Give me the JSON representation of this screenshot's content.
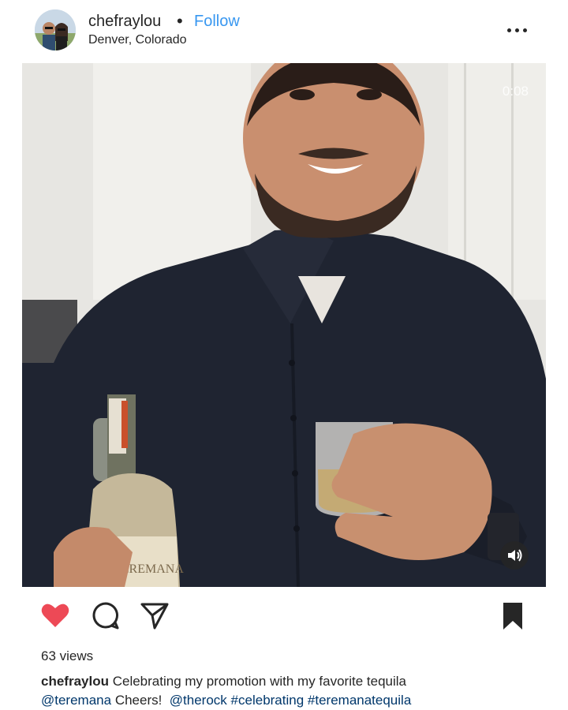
{
  "post": {
    "username": "chefraylou",
    "separator": "•",
    "follow_label": "Follow",
    "location": "Denver, Colorado"
  },
  "video": {
    "timer": "0:08",
    "bottle_label": "TEREMANA"
  },
  "actions": {
    "like_icon": "heart-icon",
    "comment_icon": "comment-icon",
    "share_icon": "send-icon",
    "save_icon": "bookmark-icon",
    "liked_color": "#ed4956"
  },
  "stats": {
    "views": "63 views"
  },
  "caption": {
    "username": "chefraylou",
    "text": "Celebrating my promotion with my favorite tequila",
    "mention1": "@teremana",
    "text2": "Cheers!",
    "mention2": "@therock",
    "hashtag1": "#celebrating",
    "hashtag2": "#teremanatequila"
  }
}
